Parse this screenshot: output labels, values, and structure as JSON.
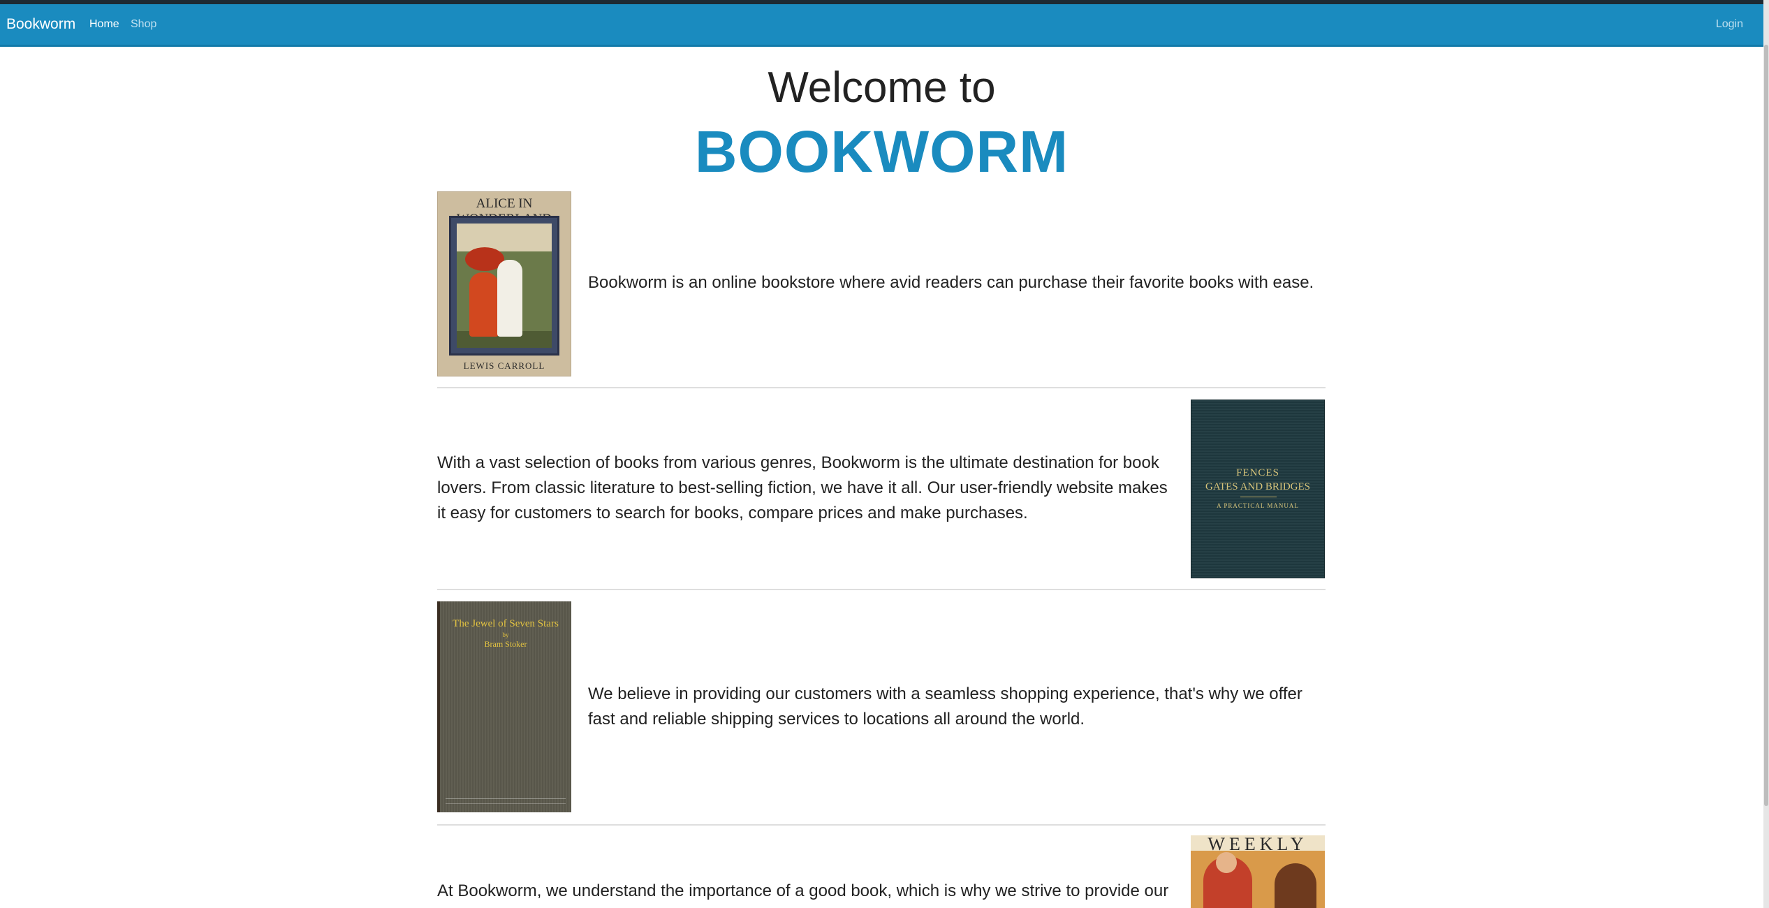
{
  "navbar": {
    "brand": "Bookworm",
    "links": [
      {
        "label": "Home"
      },
      {
        "label": "Shop"
      }
    ],
    "login": "Login"
  },
  "hero": {
    "line1": "Welcome to",
    "line2": "BOOKWORM"
  },
  "sections": [
    {
      "text": "Bookworm is an online bookstore where avid readers can purchase their favorite books with ease.",
      "cover": {
        "title": "ALICE IN WONDERLAND",
        "author": "LEWIS CARROLL"
      }
    },
    {
      "text": "With a vast selection of books from various genres, Bookworm is the ultimate destination for book lovers. From classic literature to best-selling fiction, we have it all. Our user-friendly website makes it easy for customers to search for books, compare prices and make purchases.",
      "cover": {
        "line1": "FENCES",
        "line2": "GATES AND BRIDGES",
        "line3": "A PRACTICAL MANUAL"
      }
    },
    {
      "text": "We believe in providing our customers with a seamless shopping experience, that's why we offer fast and reliable shipping services to locations all around the world.",
      "cover": {
        "title": "The Jewel of Seven Stars",
        "by": "by",
        "author": "Bram Stoker"
      }
    },
    {
      "text": "At Bookworm, we understand the importance of a good book, which is why we strive to provide our",
      "cover": {
        "title": "WEEKLY"
      }
    }
  ],
  "colors": {
    "navbar": "#1a8bbf",
    "accent": "#1a8bbf",
    "text": "#222222",
    "divider": "#dedede"
  }
}
